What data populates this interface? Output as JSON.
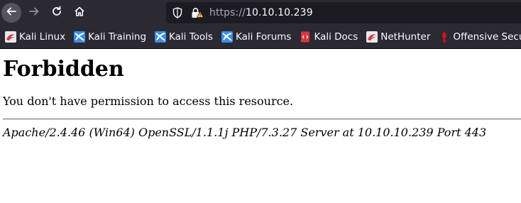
{
  "toolbar": {
    "url_scheme": "https://",
    "url_host": "10.10.10.239"
  },
  "bookmarks": [
    {
      "label": "Kali Linux",
      "icon": "kali-dragon-icon"
    },
    {
      "label": "Kali Training",
      "icon": "kali-training-icon"
    },
    {
      "label": "Kali Tools",
      "icon": "kali-tools-icon"
    },
    {
      "label": "Kali Forums",
      "icon": "kali-forums-icon"
    },
    {
      "label": "Kali Docs",
      "icon": "kali-docs-icon"
    },
    {
      "label": "NetHunter",
      "icon": "nethunter-icon"
    },
    {
      "label": "Offensive Secu",
      "icon": "offensive-security-icon"
    }
  ],
  "page": {
    "heading": "Forbidden",
    "message": "You don't have permission to access this resource.",
    "server_signature": "Apache/2.4.46 (Win64) OpenSSL/1.1.1j PHP/7.3.27 Server at 10.10.10.239 Port 443"
  }
}
